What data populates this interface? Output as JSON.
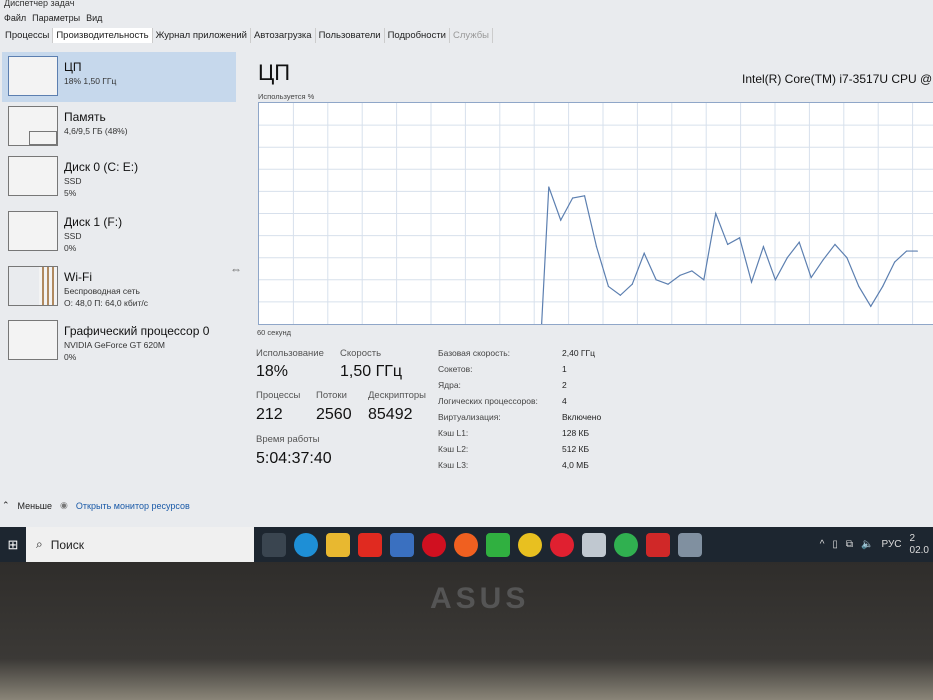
{
  "window": {
    "title": "Диспетчер задач",
    "menu": [
      "Файл",
      "Параметры",
      "Вид"
    ],
    "tabs": [
      "Процессы",
      "Производительность",
      "Журнал приложений",
      "Автозагрузка",
      "Пользователи",
      "Подробности",
      "Службы"
    ]
  },
  "sidebar": [
    {
      "title": "ЦП",
      "line1": "18%  1,50 ГГц",
      "line2": ""
    },
    {
      "title": "Память",
      "line1": "4,6/9,5 ГБ (48%)",
      "line2": ""
    },
    {
      "title": "Диск 0 (C: E:)",
      "line1": "SSD",
      "line2": "5%"
    },
    {
      "title": "Диск 1 (F:)",
      "line1": "SSD",
      "line2": "0%"
    },
    {
      "title": "Wi-Fi",
      "line1": "Беспроводная сеть",
      "line2": "О: 48,0  П: 64,0 кбит/с"
    },
    {
      "title": "Графический процессор 0",
      "line1": "NVIDIA GeForce GT 620M",
      "line2": "0%"
    }
  ],
  "main": {
    "title": "ЦП",
    "cpu_name": "Intel(R) Core(TM) i7-3517U CPU @",
    "y_label": "Используется %",
    "x_label": "60 секунд",
    "stats": {
      "usage_label": "Использование",
      "usage": "18%",
      "speed_label": "Скорость",
      "speed": "1,50 ГГц",
      "proc_label": "Процессы",
      "proc": "212",
      "threads_label": "Потоки",
      "threads": "2560",
      "handles_label": "Дескрипторы",
      "handles": "85492",
      "uptime_label": "Время работы",
      "uptime": "5:04:37:40"
    },
    "specs": [
      [
        "Базовая скорость:",
        "2,40 ГГц"
      ],
      [
        "Сокетов:",
        "1"
      ],
      [
        "Ядра:",
        "2"
      ],
      [
        "Логических процессоров:",
        "4"
      ],
      [
        "Виртуализация:",
        "Включено"
      ],
      [
        "Кэш L1:",
        "128 КБ"
      ],
      [
        "Кэш L2:",
        "512 КБ"
      ],
      [
        "Кэш L3:",
        "4,0 МБ"
      ]
    ]
  },
  "footer": {
    "less": "Меньше",
    "monitor": "Открыть монитор ресурсов"
  },
  "taskbar": {
    "search": "Поиск",
    "lang": "РУС",
    "clock_time": "2",
    "clock_date": "02.0"
  },
  "bezel": {
    "brand": "ASUS"
  },
  "chart_data": {
    "type": "line",
    "title": "ЦП",
    "ylabel": "Используется %",
    "xlabel": "60 секунд",
    "ylim": [
      0,
      100
    ],
    "xlim": [
      0,
      60
    ],
    "x": [
      23.7,
      24.3,
      25.3,
      26.3,
      27.3,
      28.3,
      29.3,
      30.3,
      31.3,
      32.3,
      33.3,
      34.3,
      35.3,
      36.3,
      37.3,
      38.3,
      39.3,
      40.3,
      41.3,
      42.3,
      43.3,
      44.3,
      45.3,
      46.3,
      47.3,
      48.3,
      49.3,
      50.3,
      51.3,
      52.3,
      53.3,
      54.3,
      55.2
    ],
    "values": [
      0,
      62,
      47,
      57,
      58,
      35,
      17,
      13,
      18,
      32,
      20,
      18,
      22,
      24,
      20,
      50,
      36,
      39,
      19,
      35,
      20,
      30,
      37,
      21,
      29,
      36,
      30,
      17,
      8,
      17,
      28,
      33,
      33
    ],
    "colors": {
      "line": "#5c7fb0",
      "grid": "#d7e0ec"
    }
  }
}
